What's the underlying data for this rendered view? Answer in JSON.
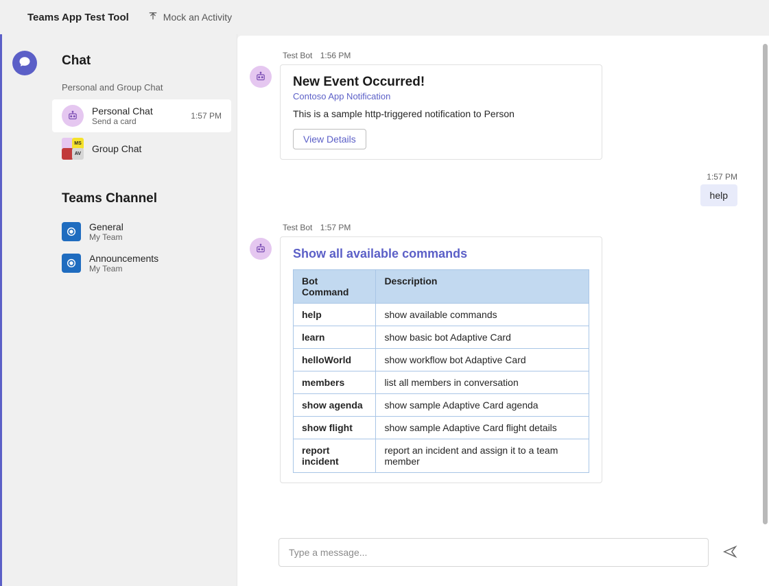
{
  "topbar": {
    "title": "Teams App Test Tool",
    "mock_label": "Mock an Activity"
  },
  "rail": {
    "chat_icon": "chat-icon"
  },
  "sidebar": {
    "chat_header": "Chat",
    "chat_subheader": "Personal and Group Chat",
    "items": [
      {
        "title": "Personal Chat",
        "sub": "Send a card",
        "time": "1:57 PM",
        "active": true
      },
      {
        "title": "Group Chat",
        "sub": "",
        "time": "",
        "active": false
      }
    ],
    "channel_header": "Teams Channel",
    "channels": [
      {
        "title": "General",
        "sub": "My Team"
      },
      {
        "title": "Announcements",
        "sub": "My Team"
      }
    ]
  },
  "messages": {
    "m0": {
      "sender": "Test Bot",
      "time": "1:56 PM",
      "card": {
        "title": "New Event Occurred!",
        "subtitle": "Contoso App Notification",
        "body": "This is a sample http-triggered notification to Person",
        "button": "View Details"
      }
    },
    "out0": {
      "time": "1:57 PM",
      "text": "help"
    },
    "m1": {
      "sender": "Test Bot",
      "time": "1:57 PM",
      "card": {
        "title": "Show all available commands",
        "headers": {
          "cmd": "Bot Command",
          "desc": "Description"
        },
        "rows": [
          {
            "cmd": "help",
            "desc": "show available commands"
          },
          {
            "cmd": "learn",
            "desc": "show basic bot Adaptive Card"
          },
          {
            "cmd": "helloWorld",
            "desc": "show workflow bot Adaptive Card"
          },
          {
            "cmd": "members",
            "desc": "list all members in conversation"
          },
          {
            "cmd": "show agenda",
            "desc": "show sample Adaptive Card agenda"
          },
          {
            "cmd": "show flight",
            "desc": "show sample Adaptive Card flight details"
          },
          {
            "cmd": "report incident",
            "desc": "report an incident and assign it to a team member"
          }
        ]
      }
    }
  },
  "composer": {
    "placeholder": "Type a message..."
  }
}
